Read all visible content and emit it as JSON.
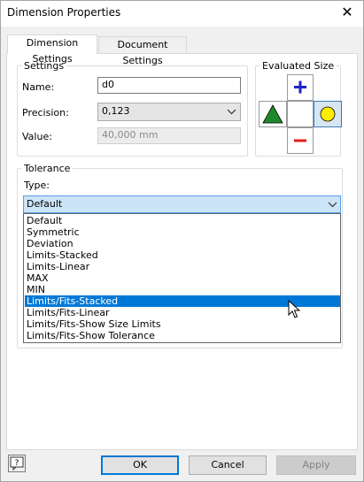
{
  "window": {
    "title": "Dimension Properties",
    "close_glyph": "✕"
  },
  "tabs": [
    {
      "label": "Dimension Settings",
      "active": true
    },
    {
      "label": "Document Settings",
      "active": false
    }
  ],
  "settings": {
    "group_label": "Settings",
    "name_label": "Name:",
    "name_value": "d0",
    "precision_label": "Precision:",
    "precision_value": "0,123",
    "value_label": "Value:",
    "value_value": "40,000 mm"
  },
  "evaluated_size": {
    "group_label": "Evaluated Size",
    "plus_icon": "plus-icon",
    "minus_icon": "minus-icon",
    "triangle_icon": "triangle-icon",
    "circle_icon": "circle-icon",
    "colors": {
      "plus": "#1e22c8",
      "minus": "#e01e1e",
      "triangle": "#1f8a2a",
      "circle": "#ffee00"
    }
  },
  "tolerance": {
    "group_label": "Tolerance",
    "type_label": "Type:",
    "type_value": "Default",
    "options": [
      "Default",
      "Symmetric",
      "Deviation",
      "Limits-Stacked",
      "Limits-Linear",
      "MAX",
      "MIN",
      "Limits/Fits-Stacked",
      "Limits/Fits-Linear",
      "Limits/Fits-Show Size Limits",
      "Limits/Fits-Show Tolerance"
    ],
    "highlighted": "Limits/Fits-Stacked"
  },
  "footer": {
    "help_icon": "help-icon",
    "help_glyph": "?",
    "ok_label": "OK",
    "cancel_label": "Cancel",
    "apply_label": "Apply"
  }
}
